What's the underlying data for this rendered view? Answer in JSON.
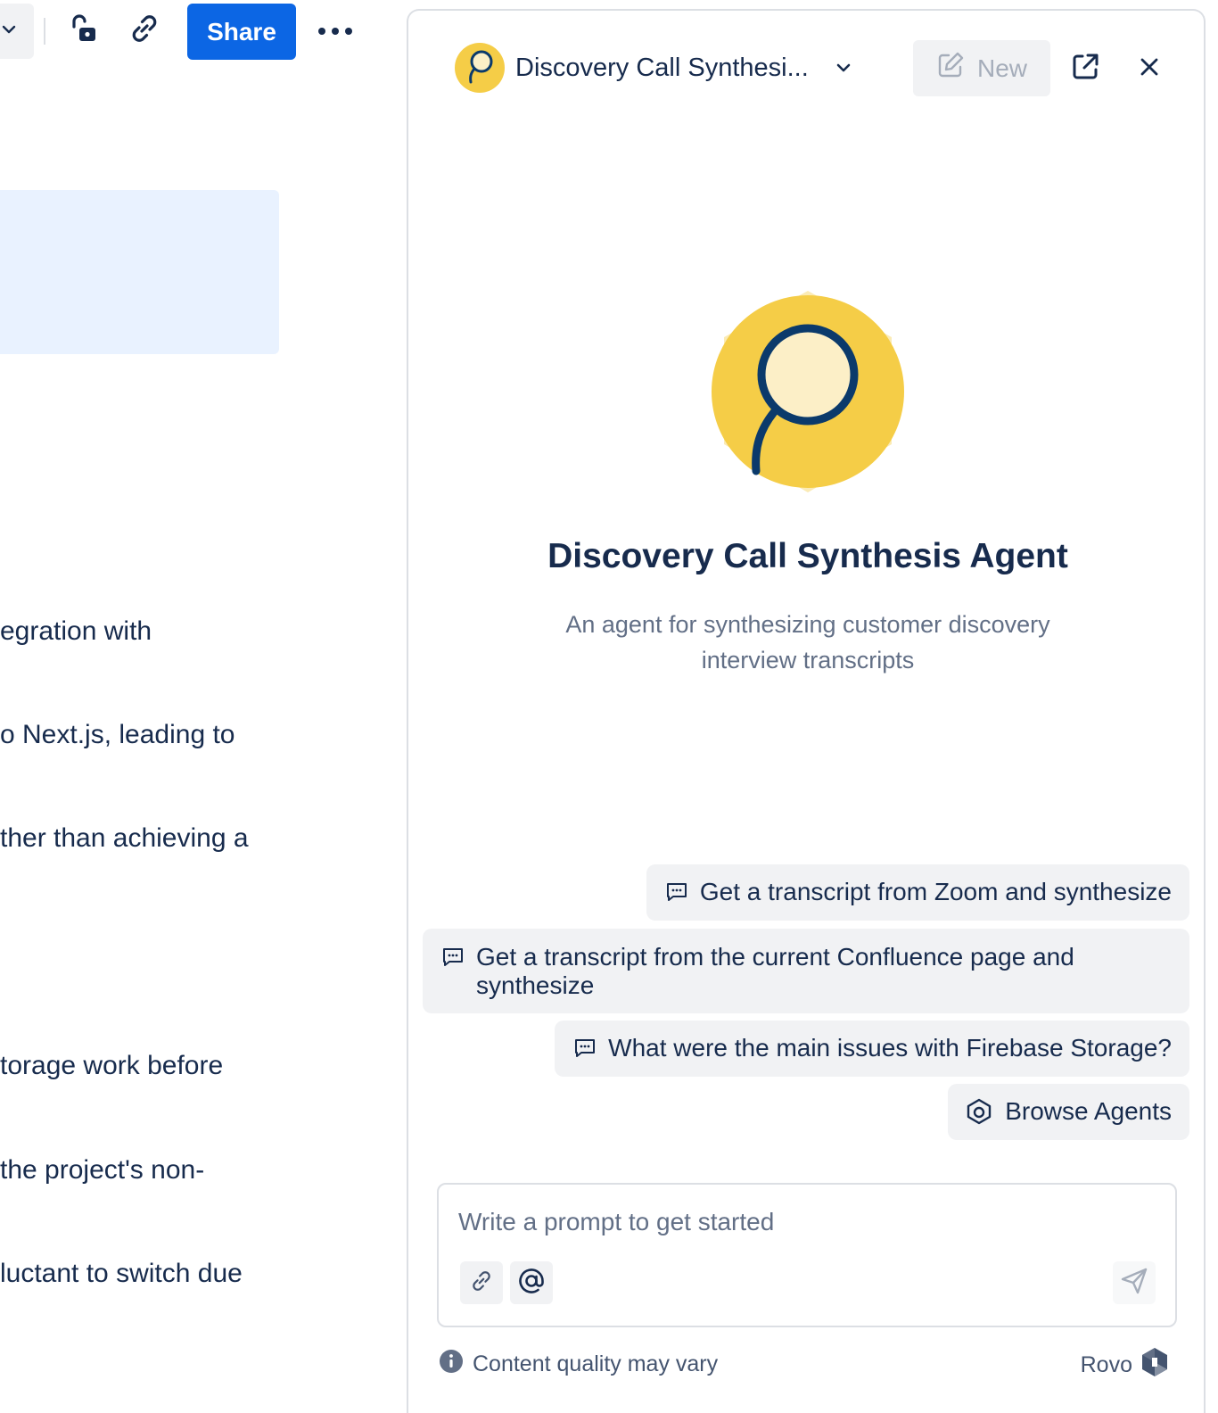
{
  "toolbar": {
    "share_label": "Share",
    "icons": [
      "chevron-down-icon",
      "unlock-icon",
      "link-icon",
      "more-icon"
    ]
  },
  "page": {
    "lines": [
      "egration with",
      "o Next.js, leading to",
      "ther than achieving a",
      "torage work before",
      "the project's non-",
      "luctant to switch due"
    ]
  },
  "panel": {
    "title": "Discovery Call Synthesi...",
    "new_label": "New",
    "agent_name": "Discovery Call Synthesis Agent",
    "agent_description": "An agent for synthesizing customer discovery interview transcripts",
    "suggestions": [
      "Get a transcript from Zoom and synthesize",
      "Get a transcript from the current Confluence page and synthesize",
      "What were the main issues with Firebase Storage?"
    ],
    "browse_agents_label": "Browse Agents",
    "prompt_placeholder": "Write a prompt to get started",
    "footer_note": "Content quality may vary",
    "brand_label": "Rovo"
  },
  "colors": {
    "primary": "#0C66E4",
    "agent_yellow": "#F5CD47",
    "agent_ring": "#0B3A6B",
    "text": "#172B4D",
    "subtle_text": "#626F86",
    "chip_bg": "#F1F2F4",
    "highlight_bg": "#E9F2FF"
  }
}
